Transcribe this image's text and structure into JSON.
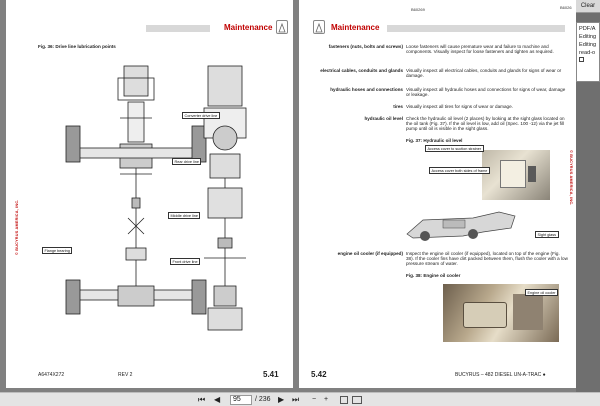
{
  "viewer": {
    "left_page": {
      "section_title": "Maintenance",
      "figure_caption": "Fig. 36: Drive line lubrication points",
      "side_text": "© BUCYRUS AMERICA, INC.",
      "footer_left": "A6474X272",
      "footer_mid": "REV 2",
      "page_number": "5.41",
      "callouts": {
        "converter": "Converter drive line",
        "rear": "Rear drive line",
        "middle": "Middle drive line",
        "flange": "Flange bearing",
        "front": "Front drive line"
      }
    },
    "right_page": {
      "page_id": "B60269",
      "section_title": "Maintenance",
      "side_text": "© BUCYRUS AMERICA, INC.",
      "rows": [
        {
          "label": "fasteners (nuts, bolts and screws)",
          "body": "Loose fasteners will cause premature wear and failure to machine and components. Visually inspect for loose fasteners and tighten as required."
        },
        {
          "label": "electrical cables, conduits and glands",
          "body": "Visually inspect all electrical cables, conduits and glands for signs of wear or damage."
        },
        {
          "label": "hydraulic hoses and connections",
          "body": "Visually inspect all hydraulic hoses and connections for signs of wear, damage or leakage."
        },
        {
          "label": "tires",
          "body": "Visually inspect all tires for signs of wear or damage."
        },
        {
          "label": "hydraulic oil level",
          "body": "Check the hydraulic oil level (2 places) by looking at the sight glass located on the oil tank (Fig. 37). If the oil level is low, add oil (Spec. 100 -12) via the jet fill pump until oil is visible in the sight glass."
        }
      ],
      "fig37_caption": "Fig. 37: Hydraulic oil level",
      "fig37_callouts": {
        "access_cover": "Access cover to suction strainer",
        "access_both": "Access cover both sides of frame",
        "sight_glass": "Sight glass"
      },
      "cooler_label": "engine oil cooler (if equipped)",
      "cooler_body": "Inspect the engine oil cooler (if equipped), located on top of the engine (Fig. 38). If the cooler fins have dirt packed between them, flush the cooler with a low pressure stream of water.",
      "fig38_caption": "Fig. 38: Engine oil cooler",
      "fig38_callout": "Engine oil cooler",
      "footer_left": "5.42",
      "footer_right": "BUCYRUS – 482 DIESEL UN-A-TRAC ●"
    }
  },
  "toolbar": {
    "current_page": "95",
    "total_pages": "/ 236",
    "first": "⏮",
    "prev": "◀",
    "next": "▶",
    "last": "⏭"
  },
  "side": {
    "clear_label": "Clear",
    "popup_lines": [
      "PDF/A",
      "Editing",
      "Editing",
      "read-o"
    ],
    "page_id_partial": "B6026"
  }
}
